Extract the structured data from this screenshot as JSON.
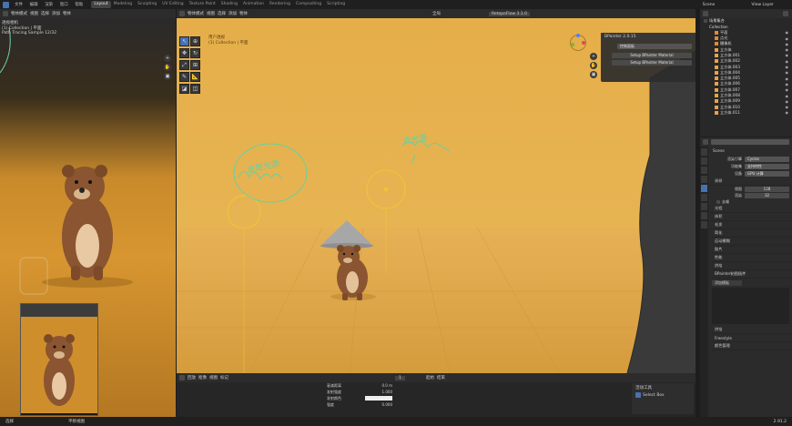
{
  "app": {
    "menu": [
      "文件",
      "编辑",
      "渲染",
      "窗口",
      "帮助"
    ],
    "workspace_tabs": [
      "Layout",
      "Modeling",
      "Sculpting",
      "UV Editing",
      "Texture Paint",
      "Shading",
      "Animation",
      "Rendering",
      "Compositing",
      "Scripting"
    ],
    "active_tab": "Layout",
    "scene_label": "Scene",
    "view_layer_label": "View Layer"
  },
  "left_viewport": {
    "title": "透视相机",
    "subtitle": "(1) Collection | 平面",
    "sample_info": "Path Tracing Sample 12/32",
    "header_labels": [
      "物体模式",
      "视图",
      "选择",
      "添加",
      "物体"
    ]
  },
  "main_viewport": {
    "mode_label": "物体模式",
    "menus": [
      "视图",
      "选择",
      "添加",
      "物体"
    ],
    "transform_label": "全局",
    "overlay_title": "用户透视",
    "overlay_sub": "(1) Collection | 平面",
    "tab_label": "RetopoFlow 3.1.0",
    "annotations": [
      "这是光源",
      "点光源"
    ]
  },
  "bpainter": {
    "title": "BPainter 2.0.15",
    "dropdown": "控制面板",
    "buttons": [
      "Setup BPainter Material",
      "Setup BPainter Material"
    ]
  },
  "outliner": {
    "title": "场景集合",
    "collection": "Collection",
    "items": [
      "平面",
      "点光",
      "摄像机",
      "立方体",
      "立方体.001",
      "立方体.002",
      "立方体.003",
      "立方体.004",
      "立方体.005",
      "立方体.006",
      "立方体.007",
      "立方体.008",
      "立方体.009",
      "立方体.010",
      "立方体.011"
    ]
  },
  "properties": {
    "scene_name": "Scene",
    "render_engine_label": "渲染引擎",
    "render_engine": "Cycles",
    "feature_set_label": "功能集",
    "feature_set": "支持特性",
    "device_label": "设备",
    "device": "GPU 计算",
    "sections": [
      "采样",
      "光程",
      "体积",
      "毛发",
      "简化",
      "运动模糊",
      "胶片",
      "性能",
      "烘焙",
      "BPainter制图插件"
    ],
    "viewport_label": "视图",
    "render_label": "渲染",
    "viewport_samples": "128",
    "render_samples": "32",
    "denoise_label": "去噪",
    "bottom_sections": [
      "颜色管理",
      "Freestyle",
      "烘焙"
    ],
    "button_label": "添加模板"
  },
  "timeline": {
    "menus": [
      "回放",
      "抠像",
      "视图",
      "标记"
    ],
    "current_frame": "1",
    "start_label": "起始",
    "end_label": "结束",
    "fields": [
      {
        "label": "衰减距离",
        "value": "0.0 m"
      },
      {
        "label": "发射强度",
        "value": "1.000"
      },
      {
        "label": "发射颜色",
        "value": ""
      },
      {
        "label": "强度",
        "value": "0.000"
      }
    ],
    "tool_panel_title": "活动工具",
    "tool_name": "Select Box"
  },
  "statusbar": {
    "left": [
      "选择",
      "平移视图"
    ],
    "version": "2.91.2"
  },
  "colors": {
    "wall": "#e7b24b",
    "floor": "#d9a443",
    "accent": "#4772b3",
    "annotation": "#5fd3a6",
    "light_gizmo": "#f0c637"
  }
}
